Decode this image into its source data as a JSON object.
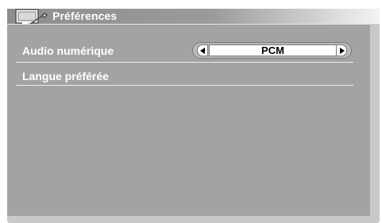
{
  "header": {
    "title": "Préférences",
    "icon": "wrench-monitor-icon"
  },
  "settings": {
    "items": [
      {
        "label": "Audio numérique",
        "value": "PCM",
        "controls": [
          "arrow-left-icon",
          "arrow-right-icon"
        ]
      },
      {
        "label": "Langue préférée"
      }
    ]
  },
  "colors": {
    "panel": "#a3a3a3",
    "frame": "#c9c9c9",
    "text": "#ffffff",
    "selector_value": "#000000"
  }
}
